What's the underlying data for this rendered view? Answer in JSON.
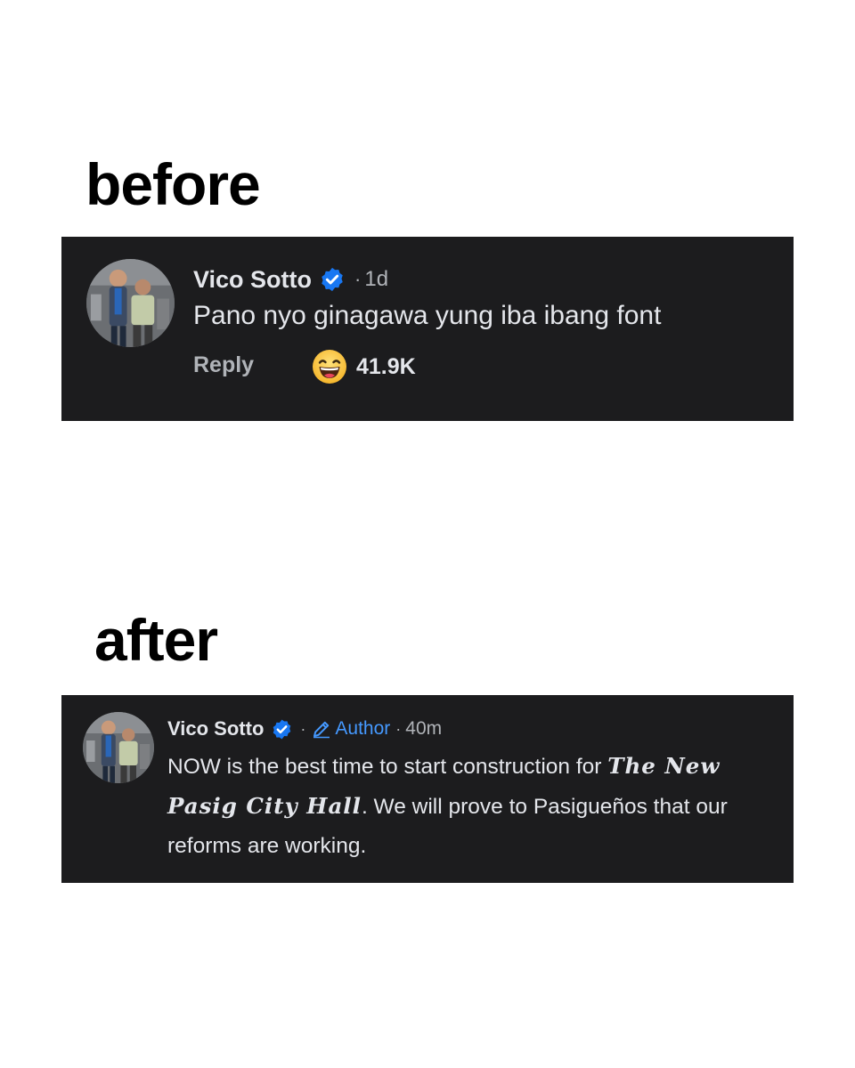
{
  "headings": {
    "before": "before",
    "after": "after"
  },
  "before_comment": {
    "author": "Vico Sotto",
    "verified_icon": "verified-badge-icon",
    "separator": "·",
    "time": "1d",
    "text": "Pano nyo ginagawa yung iba ibang font",
    "reply_label": "Reply",
    "reaction_icon": "laughing-emoji-icon",
    "reaction_count": "41.9K"
  },
  "after_comment": {
    "author": "Vico Sotto",
    "verified_icon": "verified-badge-icon",
    "separator": "·",
    "author_badge_icon": "pencil-icon",
    "author_badge_label": "Author",
    "separator2": "·",
    "time": "40m",
    "text_part1": "NOW is the best time to start construction for ",
    "text_fancy": "The New Pasig City Hall",
    "text_part2": ". We will prove to Pasigueños that our reforms are working."
  },
  "colors": {
    "card_background": "#1c1c1e",
    "primary_text": "#e4e6eb",
    "secondary_text": "#b0b3b8",
    "verified_blue": "#1877f2",
    "author_blue": "#4599ff"
  }
}
